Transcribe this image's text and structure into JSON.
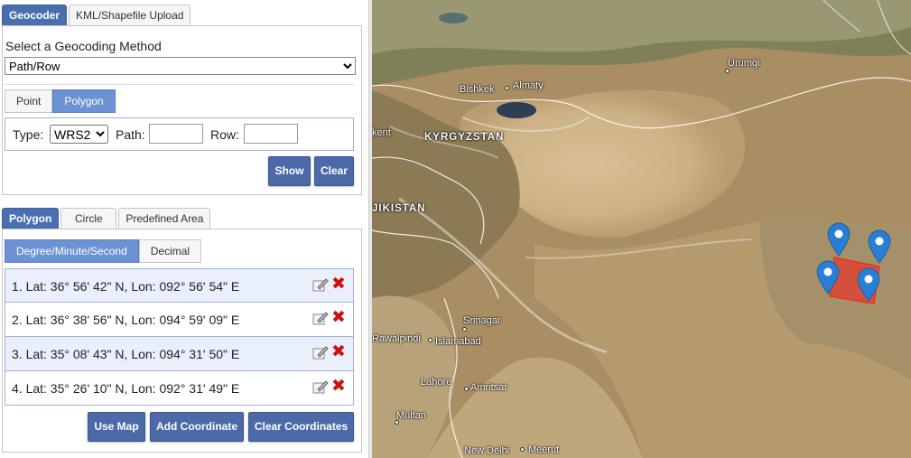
{
  "geocoder_tabs": [
    "Geocoder",
    "KML/Shapefile Upload"
  ],
  "method": {
    "label": "Select a Geocoding Method",
    "value": "Path/Row"
  },
  "shape_buttons": [
    "Point",
    "Polygon"
  ],
  "type_row": {
    "type_label": "Type:",
    "type_value": "WRS2",
    "path_label": "Path:",
    "row_label": "Row:"
  },
  "actions1": {
    "show": "Show",
    "clear": "Clear"
  },
  "area_tabs": [
    "Polygon",
    "Circle",
    "Predefined Area"
  ],
  "format_buttons": [
    "Degree/Minute/Second",
    "Decimal"
  ],
  "coordinates": [
    "1.  Lat: 36° 56' 42\" N, Lon: 092° 56' 54\" E",
    "2.  Lat: 36° 38' 56\" N, Lon: 094° 59' 09\" E",
    "3.  Lat: 35° 08' 43\" N, Lon: 094° 31' 50\" E",
    "4.  Lat: 35° 26' 10\" N, Lon: 092° 31' 49\" E"
  ],
  "actions2": {
    "use_map": "Use Map",
    "add": "Add Coordinate",
    "clear_all": "Clear Coordinates"
  },
  "map_labels": {
    "urumqi": "Urumqi",
    "bishkek": "Bishkek",
    "almaty": "Almaty",
    "kent": "kent",
    "kyrgyzstan": "KYRGYZSTAN",
    "jikistan": "JIKISTAN",
    "srinagar": "Srinagar",
    "rawalpindi": "Rawalpindi",
    "islamabad": "Islamabad",
    "lahore": "Lahore",
    "amritsar": "Amritsar",
    "multan": "Multan",
    "newdelhi": "New Delhi",
    "meerut": "Meerut"
  },
  "colors": {
    "accent": "#4a6fb0",
    "polygon": "#e8342a",
    "pin": "#2a7fd4"
  }
}
